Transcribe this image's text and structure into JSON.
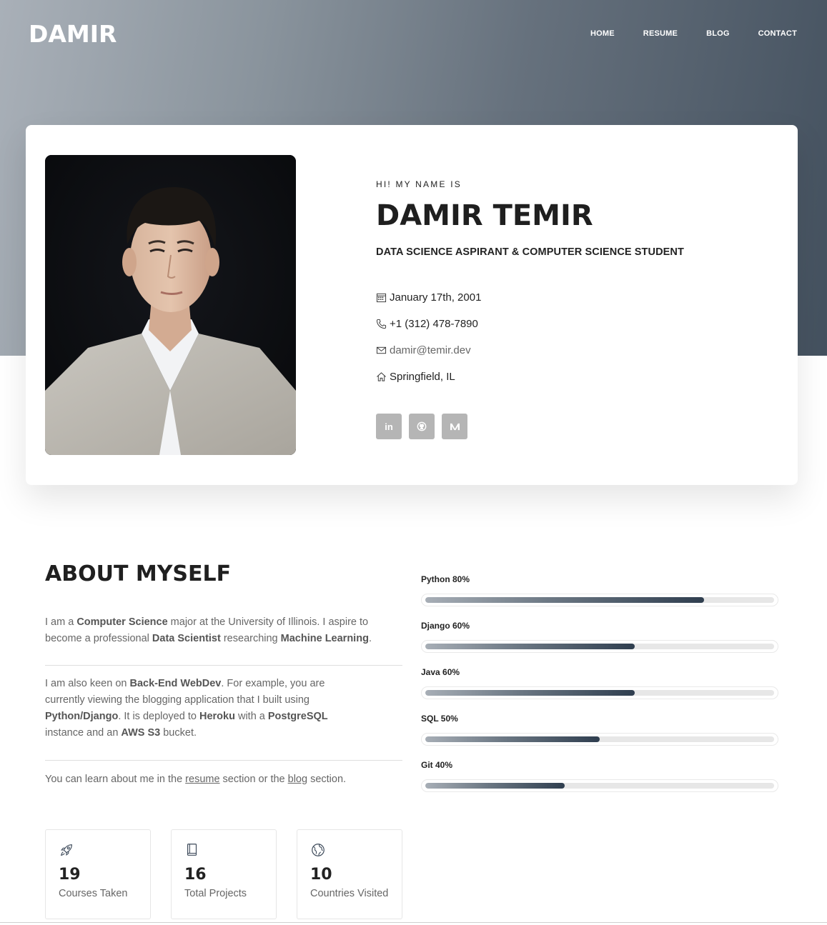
{
  "nav": {
    "brand": "DAMIR",
    "links": [
      "HOME",
      "RESUME",
      "BLOG",
      "CONTACT"
    ]
  },
  "profile": {
    "greeting": "HI! MY NAME IS",
    "name": "DAMIR TEMIR",
    "subtitle": "DATA SCIENCE ASPIRANT & COMPUTER SCIENCE STUDENT",
    "birthday": "January 17th, 2001",
    "phone": "+1 (312) 478-7890",
    "email": "damir@temir.dev",
    "location": "Springfield, IL",
    "socials": [
      {
        "icon": "linkedin-icon",
        "glyph": "in"
      },
      {
        "icon": "github-icon",
        "glyph": ""
      },
      {
        "icon": "medium-icon",
        "glyph": ""
      }
    ]
  },
  "about": {
    "title": "ABOUT MYSELF",
    "p1": {
      "t1": "I am a ",
      "b1": "Computer Science",
      "t2": " major at the University of Illinois. I aspire to become a professional ",
      "b2": "Data Scientist",
      "t3": " researching ",
      "b3": "Machine Learning",
      "t4": "."
    },
    "p2": {
      "t1": "I am also keen on ",
      "b1": "Back-End WebDev",
      "t2": ". For example, you are currently viewing the blogging application that I built using ",
      "b2": "Python/Django",
      "t3": ". It is deployed to ",
      "b3": "Heroku",
      "t4": " with a ",
      "b4": "PostgreSQL",
      "t5": " instance and an ",
      "b5": "AWS S3",
      "t6": " bucket."
    },
    "p3": {
      "t1": "You can learn about me in the ",
      "link1": "resume",
      "t2": " section or the ",
      "link2": "blog",
      "t3": " section."
    }
  },
  "stats": [
    {
      "icon": "rocket-icon",
      "value": "19",
      "label": "Courses Taken"
    },
    {
      "icon": "book-icon",
      "value": "16",
      "label": "Total Projects"
    },
    {
      "icon": "globe-icon",
      "value": "10",
      "label": "Countries Visited"
    }
  ],
  "skills": [
    {
      "label": "Python 80%",
      "level": 0.8
    },
    {
      "label": "Django 60%",
      "level": 0.6
    },
    {
      "label": "Java 60%",
      "level": 0.6
    },
    {
      "label": "SQL 50%",
      "level": 0.5
    },
    {
      "label": "Git 40%",
      "level": 0.4
    }
  ]
}
